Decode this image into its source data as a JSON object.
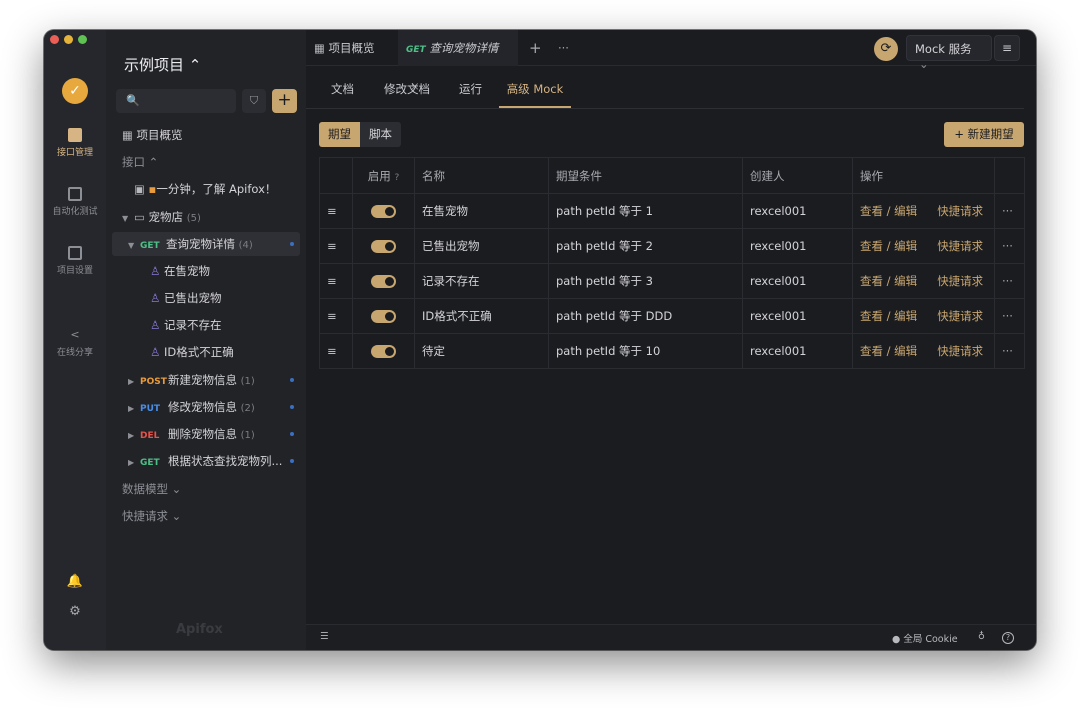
{
  "colors": {
    "accent": "#c8a66f",
    "get": "#4fbf88",
    "post": "#e79b3c",
    "put": "#4a8de6",
    "del": "#e5534b",
    "light_red": "#ec5f57",
    "light_yellow": "#e5b33a",
    "light_green": "#5fc252"
  },
  "rail": {
    "items": [
      {
        "label": "接口管理",
        "icon": "api-manage-icon"
      },
      {
        "label": "自动化测试",
        "icon": "automation-icon"
      },
      {
        "label": "项目设置",
        "icon": "settings-icon"
      },
      {
        "label": "在线分享",
        "icon": "share-icon"
      }
    ],
    "bell": "🔔",
    "gear": "⚙"
  },
  "sidebar": {
    "project_title": "示例项目 ⌃",
    "search_icon": "🔍",
    "filter_icon": "⛉",
    "add_label": "+",
    "overview": "项目概览",
    "api_header": "接口 ⌃",
    "intro_doc": "一分钟，了解 Apifox！",
    "folder": {
      "name": "宠物店",
      "count": "(5)"
    },
    "selected": {
      "method": "GET",
      "name": "查询宠物详情",
      "count": "(4)"
    },
    "cases": [
      "在售宠物",
      "已售出宠物",
      "记录不存在",
      "ID格式不正确"
    ],
    "apis": [
      {
        "method": "POST",
        "name": "新建宠物信息",
        "count": "(1)"
      },
      {
        "method": "PUT",
        "name": "修改宠物信息",
        "count": "(2)"
      },
      {
        "method": "DEL",
        "name": "删除宠物信息",
        "count": "(1)"
      },
      {
        "method": "GET",
        "name": "根据状态查找宠物列...",
        "count": ""
      }
    ],
    "data_models": "数据模型 ⌄",
    "quick_requests": "快捷请求 ⌄",
    "watermark": "Apifox"
  },
  "topbar": {
    "tab_overview": "项目概览",
    "tab_active_method": "GET",
    "tab_active_name": "查询宠物详情",
    "tab_close": "×",
    "tab_add": "+",
    "tab_more": "···",
    "sync_icon": "⟳",
    "mock_service": "Mock 服务",
    "mock_caret": "⌄",
    "menu_icon": "≡"
  },
  "subtabs": [
    "文档",
    "修改文档",
    "运行",
    "高级 Mock"
  ],
  "segments": [
    "期望",
    "脚本"
  ],
  "new_expectation": "+ 新建期望",
  "table": {
    "headers": {
      "enabled": "启用",
      "name": "名称",
      "condition": "期望条件",
      "creator": "创建人",
      "actions": "操作"
    },
    "rows": [
      {
        "name": "在售宠物",
        "condition": "path   petId 等于 1",
        "creator": "rexcel001"
      },
      {
        "name": "已售出宠物",
        "condition": "path   petId 等于 2",
        "creator": "rexcel001"
      },
      {
        "name": "记录不存在",
        "condition": "path   petId 等于 3",
        "creator": "rexcel001"
      },
      {
        "name": "ID格式不正确",
        "condition": "path   petId 等于 DDD",
        "creator": "rexcel001"
      },
      {
        "name": "待定",
        "condition": "path   petId 等于 10",
        "creator": "rexcel001"
      }
    ],
    "view_edit": "查看 / 编辑",
    "quick_request": "快捷请求",
    "more": "···"
  },
  "bottombar": {
    "global_cookie": "全局 Cookie",
    "help": "?"
  }
}
